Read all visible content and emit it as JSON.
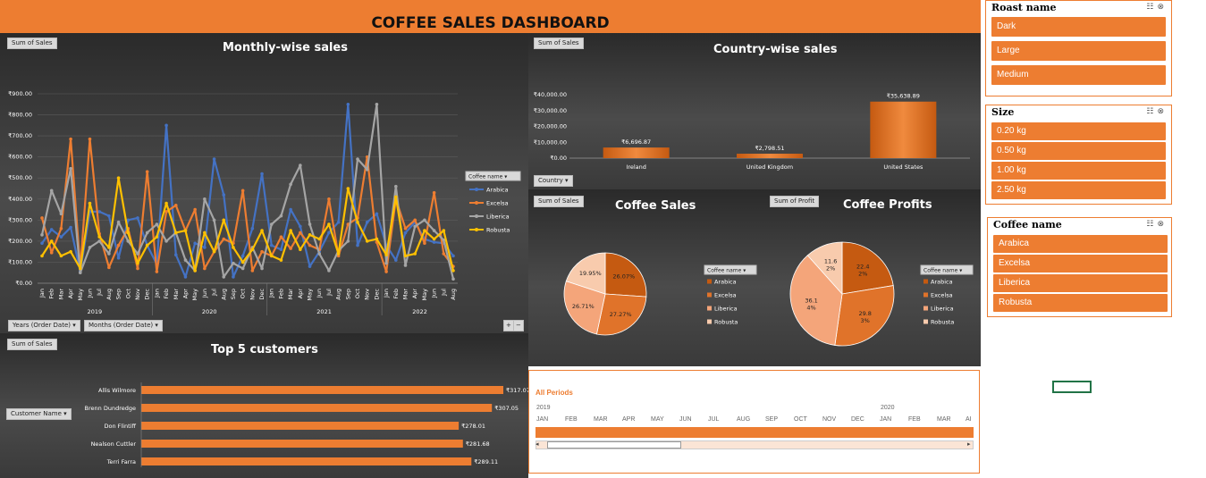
{
  "dashboard_title": "COFFEE SALES DASHBOARD",
  "colors": {
    "accent": "#ED7D31",
    "arabica": "#4472C4",
    "excelsa": "#ED7D31",
    "liberica": "#A5A5A5",
    "robusta": "#FFC000"
  },
  "monthly": {
    "field_button": "Sum of Sales",
    "filter_years": "Years (Order Date)",
    "filter_months": "Months (Order Date)",
    "legend_title": "Coffee name"
  },
  "country": {
    "field_button": "Sum of Sales",
    "filter_country": "Country"
  },
  "pie_sales": {
    "field_button": "Sum of Sales",
    "legend_title": "Coffee name"
  },
  "pie_profit": {
    "field_button": "Sum of Profit",
    "legend_title": "Coffee name"
  },
  "customers": {
    "field_button": "Sum of Sales",
    "filter_customer": "Customer Name"
  },
  "chart_data": [
    {
      "type": "line",
      "title": "Monthly-wise sales",
      "years": [
        "2019",
        "2020",
        "2021",
        "2022"
      ],
      "categories": [
        "Jan",
        "Feb",
        "Mar",
        "Apr",
        "May",
        "Jun",
        "Jul",
        "Aug",
        "Sep",
        "Oct",
        "Nov",
        "Dec",
        "Jan",
        "Feb",
        "Mar",
        "Apr",
        "May",
        "Jun",
        "Jul",
        "Aug",
        "Sep",
        "Oct",
        "Nov",
        "Dec",
        "Jan",
        "Feb",
        "Mar",
        "Apr",
        "May",
        "Jun",
        "Jul",
        "Aug",
        "Sep",
        "Oct",
        "Nov",
        "Dec",
        "Jan",
        "Feb",
        "Mar",
        "Apr",
        "May",
        "Jun",
        "Jul",
        "Aug"
      ],
      "y_tick_labels": [
        "₹0.00",
        "₹100.00",
        "₹200.00",
        "₹300.00",
        "₹400.00",
        "₹500.00",
        "₹600.00",
        "₹700.00",
        "₹800.00",
        "₹900.00"
      ],
      "ylim": [
        0,
        900
      ],
      "series": [
        {
          "name": "Arabica",
          "values": [
            190,
            255,
            220,
            265,
            55,
            340,
            340,
            320,
            120,
            300,
            310,
            180,
            90,
            750,
            135,
            30,
            190,
            170,
            590,
            420,
            30,
            130,
            260,
            520,
            180,
            160,
            350,
            270,
            80,
            150,
            240,
            290,
            850,
            180,
            290,
            330,
            180,
            110,
            240,
            290,
            210,
            195,
            190,
            130
          ]
        },
        {
          "name": "Excelsa",
          "values": [
            310,
            145,
            260,
            685,
            70,
            685,
            235,
            75,
            180,
            260,
            70,
            530,
            55,
            340,
            370,
            250,
            350,
            70,
            150,
            210,
            190,
            440,
            60,
            150,
            130,
            220,
            165,
            240,
            180,
            160,
            400,
            130,
            280,
            310,
            600,
            195,
            55,
            400,
            260,
            300,
            190,
            430,
            140,
            80
          ]
        },
        {
          "name": "Liberica",
          "values": [
            230,
            440,
            330,
            545,
            50,
            170,
            200,
            140,
            290,
            200,
            140,
            240,
            280,
            200,
            240,
            110,
            60,
            400,
            300,
            30,
            95,
            70,
            170,
            70,
            280,
            320,
            470,
            560,
            280,
            140,
            60,
            155,
            200,
            590,
            540,
            850,
            95,
            460,
            85,
            270,
            300,
            250,
            205,
            20
          ]
        },
        {
          "name": "Robusta",
          "values": [
            130,
            200,
            130,
            150,
            70,
            380,
            220,
            170,
            500,
            240,
            95,
            180,
            220,
            380,
            240,
            250,
            60,
            240,
            150,
            300,
            170,
            100,
            160,
            250,
            130,
            110,
            250,
            160,
            230,
            210,
            280,
            140,
            450,
            290,
            200,
            210,
            135,
            410,
            130,
            140,
            250,
            210,
            250,
            60
          ]
        }
      ]
    },
    {
      "type": "bar",
      "title": "Country-wise sales",
      "categories": [
        "Ireland",
        "United Kingdom",
        "United States"
      ],
      "values": [
        6696.87,
        2798.51,
        35638.89
      ],
      "data_labels": [
        "₹6,696.87",
        "₹2,798.51",
        "₹35,638.89"
      ],
      "y_tick_labels": [
        "₹0.00",
        "₹10,000.00",
        "₹20,000.00",
        "₹30,000.00",
        "₹40,000.00"
      ],
      "ylim": [
        0,
        40000
      ]
    },
    {
      "type": "pie",
      "title": "Coffee Sales",
      "categories": [
        "Arabica",
        "Excelsa",
        "Liberica",
        "Robusta"
      ],
      "values": [
        26.07,
        27.27,
        26.71,
        19.95
      ],
      "data_labels": [
        "26.07%",
        "27.27%",
        "26.71%",
        "19.95%"
      ]
    },
    {
      "type": "pie",
      "title": "Coffee Profits",
      "categories": [
        "Arabica",
        "Excelsa",
        "Liberica",
        "Robusta"
      ],
      "values": [
        22.4,
        29.83,
        36.14,
        11.62
      ],
      "data_labels": [
        [
          "22.4",
          "2%"
        ],
        [
          "29.8",
          "3%"
        ],
        [
          "36.1",
          "4%"
        ],
        [
          "11.6",
          "2%"
        ]
      ]
    },
    {
      "type": "bar",
      "orientation": "horizontal",
      "title": "Top 5 customers",
      "categories": [
        "Allis Wilmore",
        "Brenn Dundredge",
        "Don Flintiff",
        "Nealson Cuttler",
        "Terri Farra"
      ],
      "values": [
        317.07,
        307.05,
        278.01,
        281.68,
        289.11
      ],
      "data_labels": [
        "₹317.07",
        "₹307.05",
        "₹278.01",
        "₹281.68",
        "₹289.11"
      ]
    }
  ],
  "slicers": {
    "roast": {
      "title": "Roast name",
      "items": [
        "Dark",
        "Large",
        "Medium"
      ]
    },
    "size": {
      "title": "Size",
      "items": [
        "0.20 kg",
        "0.50 kg",
        "1.00 kg",
        "2.50 kg"
      ]
    },
    "coffee": {
      "title": "Coffee name",
      "items": [
        "Arabica",
        "Excelsa",
        "Liberica",
        "Robusta"
      ]
    }
  },
  "timeline": {
    "all_periods": "All Periods",
    "year_a": "2019",
    "year_b": "2020",
    "months": [
      "JAN",
      "FEB",
      "MAR",
      "APR",
      "MAY",
      "JUN",
      "JUL",
      "AUG",
      "SEP",
      "OCT",
      "NOV",
      "DEC",
      "JAN",
      "FEB",
      "MAR",
      "AI"
    ]
  }
}
